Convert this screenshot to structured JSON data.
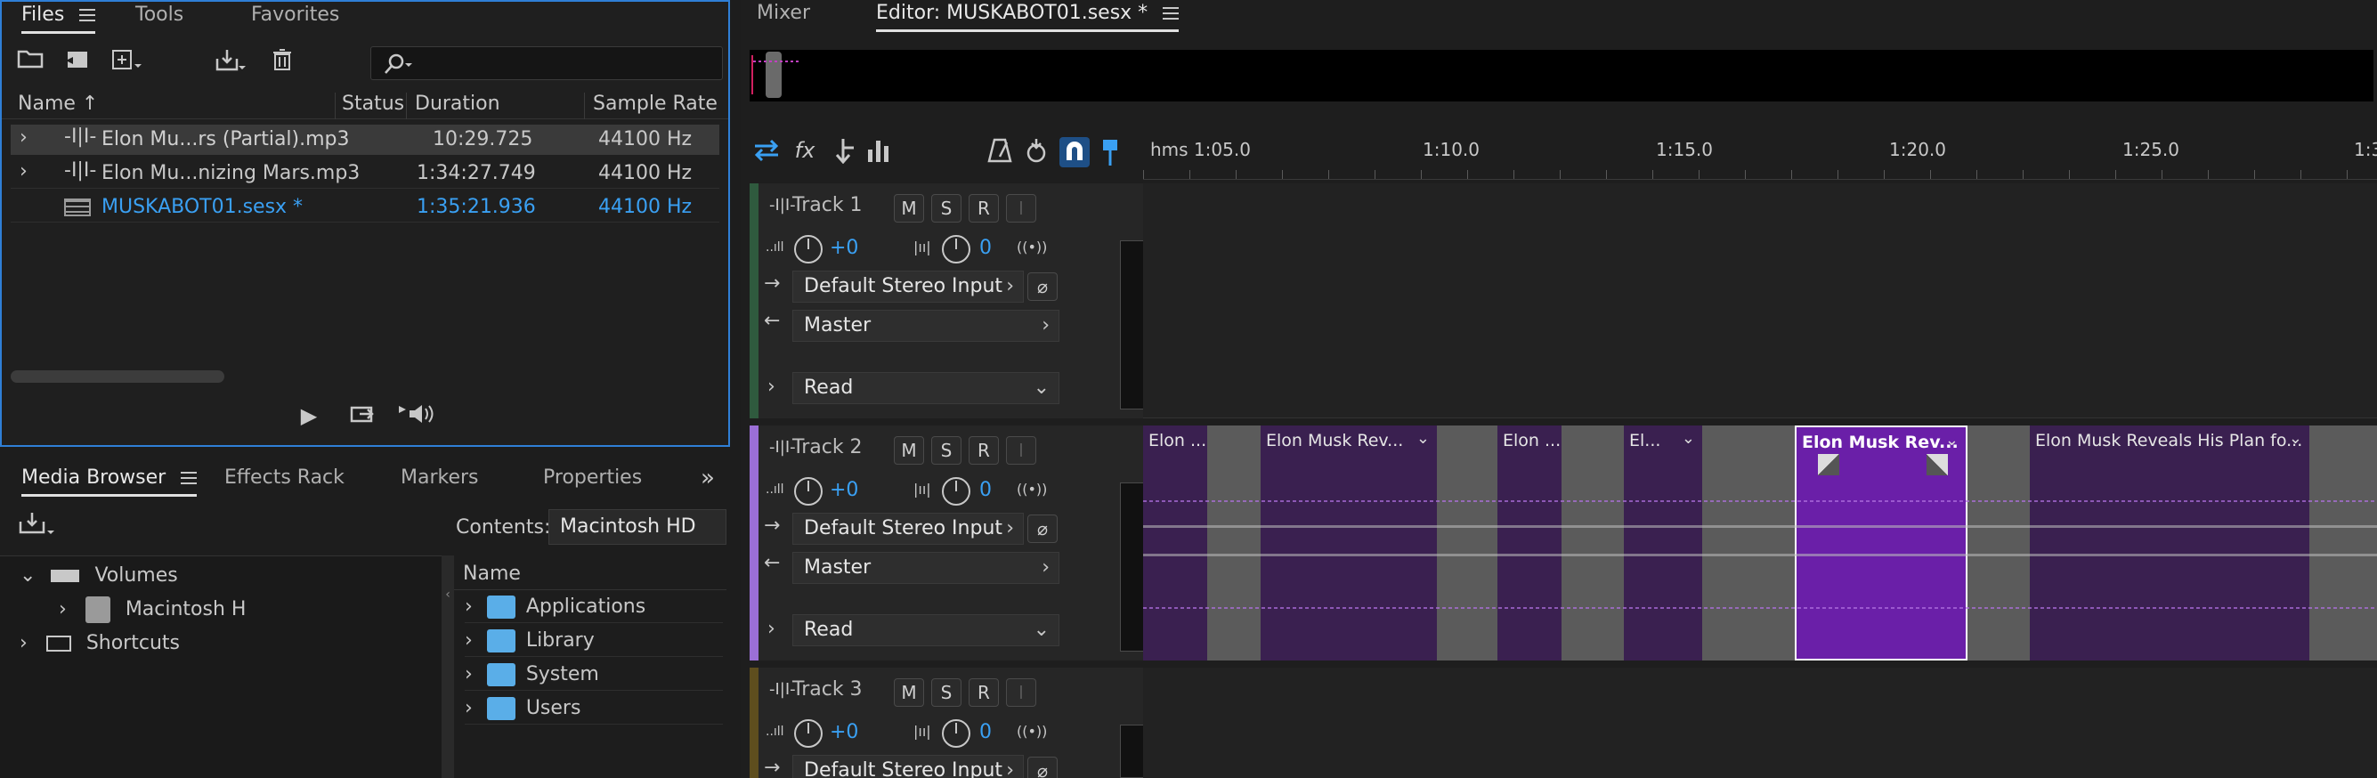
{
  "files_panel": {
    "tabs": [
      "Files",
      "Tools",
      "Favorites"
    ],
    "columns": [
      "Name",
      "Status",
      "Duration",
      "Sample Rate"
    ],
    "rows": [
      {
        "name": "Elon Mu...rs (Partial).mp3",
        "status": "",
        "duration": "10:29.725",
        "rate": "44100 Hz"
      },
      {
        "name": "Elon Mu...nizing Mars.mp3",
        "status": "",
        "duration": "1:34:27.749",
        "rate": "44100 Hz"
      },
      {
        "name": "MUSKABOT01.sesx *",
        "status": "",
        "duration": "1:35:21.936",
        "rate": "44100 Hz"
      }
    ]
  },
  "media_panel": {
    "tabs": [
      "Media Browser",
      "Effects Rack",
      "Markers",
      "Properties"
    ],
    "contents_label": "Contents:",
    "contents_value": "Macintosh HD",
    "tree": [
      "Volumes",
      "Macintosh H",
      "Shortcuts"
    ],
    "list_header": "Name",
    "list": [
      "Applications",
      "Library",
      "System",
      "Users"
    ]
  },
  "editor": {
    "tabs": [
      "Mixer",
      "Editor: MUSKABOT01.sesx *"
    ],
    "ruler": [
      "hms 1:05.0",
      "1:10.0",
      "1:15.0",
      "1:20.0",
      "1:25.0",
      "1:3"
    ],
    "tracks": [
      {
        "name": "Track 1",
        "vol": "+0",
        "pan": "0",
        "input": "Default Stereo Input",
        "output": "Master",
        "mode": "Read"
      },
      {
        "name": "Track 2",
        "vol": "+0",
        "pan": "0",
        "input": "Default Stereo Input",
        "output": "Master",
        "mode": "Read"
      },
      {
        "name": "Track 3",
        "vol": "+0",
        "pan": "0",
        "input": "Default Stereo Input",
        "output": "",
        "mode": ""
      }
    ],
    "msri": [
      "M",
      "S",
      "R",
      "I"
    ],
    "clips": [
      "Elon ...",
      "Elon Musk Rev...",
      "Elon ...",
      "El...",
      "Elon Musk Rev...",
      "Elon Musk Reveals His Plan fo..."
    ],
    "colors": {
      "accent": "#3aa0f3",
      "track2": "#9b6fd6",
      "clip": "#3a2050",
      "clip_selected": "#6a1fa8"
    }
  }
}
